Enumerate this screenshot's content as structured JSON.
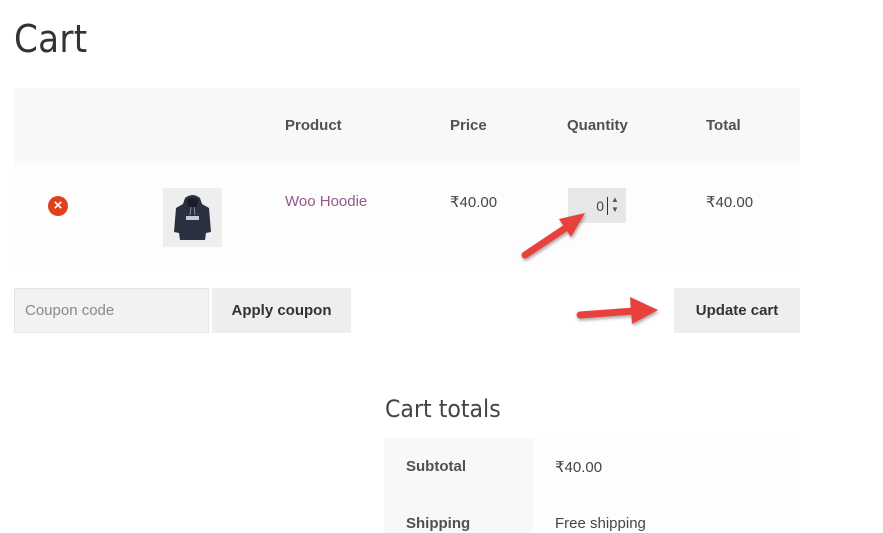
{
  "page": {
    "title": "Cart"
  },
  "cart_table": {
    "headers": {
      "product": "Product",
      "price": "Price",
      "quantity": "Quantity",
      "total": "Total"
    },
    "items": [
      {
        "remove_icon": "remove-x-icon",
        "thumbnail": "hoodie-thumbnail",
        "name": "Woo Hoodie",
        "price": "₹40.00",
        "quantity": "0",
        "total": "₹40.00"
      }
    ]
  },
  "actions": {
    "coupon_placeholder": "Coupon code",
    "apply_coupon_label": "Apply coupon",
    "update_cart_label": "Update cart"
  },
  "cart_totals": {
    "title": "Cart totals",
    "rows": [
      {
        "label": "Subtotal",
        "value": "₹40.00"
      },
      {
        "label": "Shipping",
        "value": "Free shipping"
      }
    ]
  },
  "annotations": {
    "arrow_color": "#e8403a",
    "icons": [
      "annotation-arrow-icon"
    ]
  },
  "colors": {
    "link": "#96588a",
    "remove": "#e2401c",
    "header_bg": "#f8f8f8",
    "button_bg": "#eeeeee"
  }
}
